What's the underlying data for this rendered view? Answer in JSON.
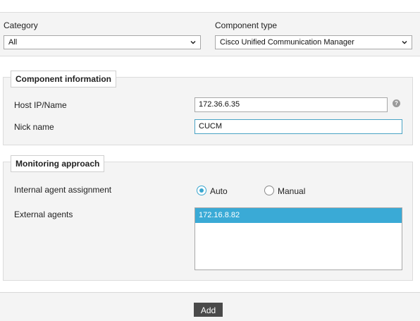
{
  "filters": {
    "category": {
      "label": "Category",
      "value": "All"
    },
    "component_type": {
      "label": "Component type",
      "value": "Cisco Unified Communication Manager"
    }
  },
  "component_info": {
    "legend": "Component information",
    "host": {
      "label": "Host IP/Name",
      "value": "172.36.6.35",
      "help": "?"
    },
    "nick": {
      "label": "Nick name",
      "value": "CUCM"
    }
  },
  "monitoring": {
    "legend": "Monitoring approach",
    "assignment": {
      "label": "Internal agent assignment",
      "options": [
        {
          "label": "Auto",
          "checked": true
        },
        {
          "label": "Manual",
          "checked": false
        }
      ]
    },
    "external_agents": {
      "label": "External agents",
      "items": [
        "172.16.8.82"
      ]
    }
  },
  "footer": {
    "add_label": "Add"
  },
  "colors": {
    "accent": "#3aaad6",
    "button_bg": "#4a4a4a",
    "panel_bg": "#f4f4f4"
  }
}
